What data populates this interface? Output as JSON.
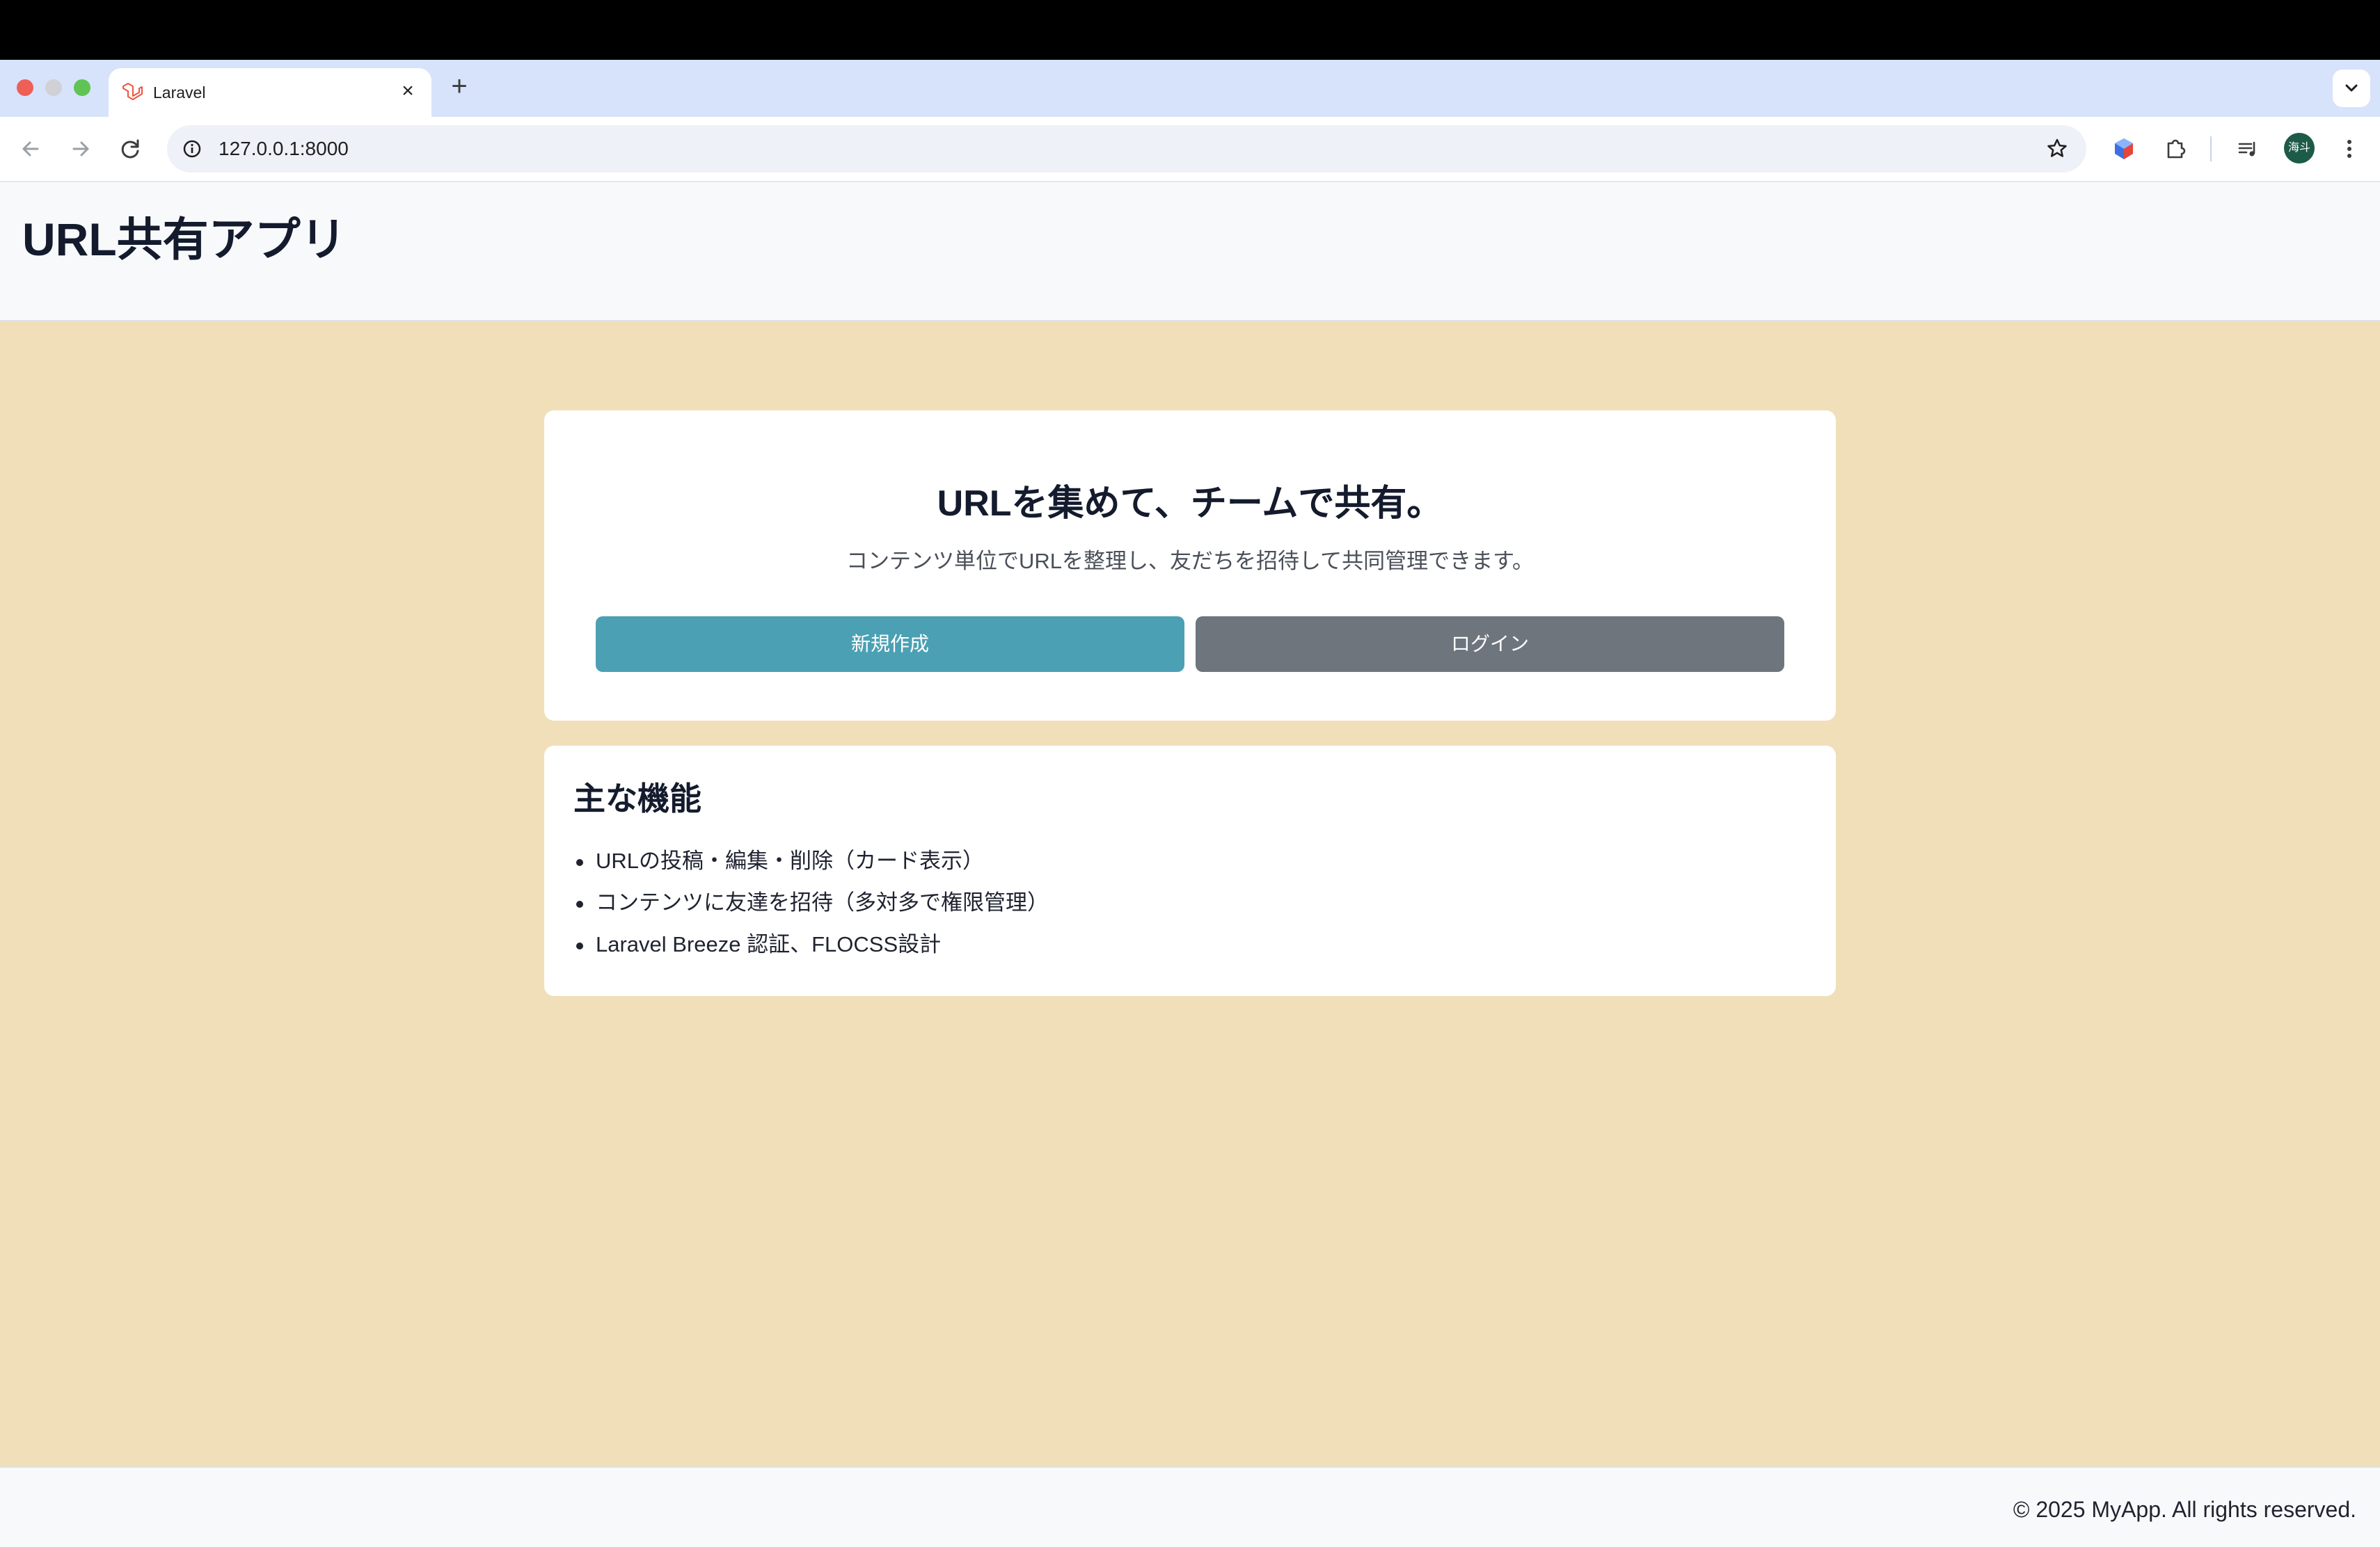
{
  "browser": {
    "tab_title": "Laravel",
    "url": "127.0.0.1:8000",
    "profile_initials": "海斗"
  },
  "header": {
    "site_title": "URL共有アプリ"
  },
  "hero": {
    "title": "URLを集めて、チームで共有。",
    "subtitle": "コンテンツ単位でURLを整理し、友だちを招待して共同管理できます。",
    "new_button": "新規作成",
    "login_button": "ログイン"
  },
  "features": {
    "title": "主な機能",
    "items": [
      "URLの投稿・編集・削除（カード表示）",
      "コンテンツに友達を招待（多対多で権限管理）",
      "Laravel Breeze 認証、FLOCSS設計"
    ]
  },
  "footer": {
    "copyright": "© 2025 MyApp. All rights reserved."
  },
  "colors": {
    "page_background": "#f0dfb9",
    "primary_button": "#4ba0b4",
    "secondary_button": "#6f757d"
  }
}
